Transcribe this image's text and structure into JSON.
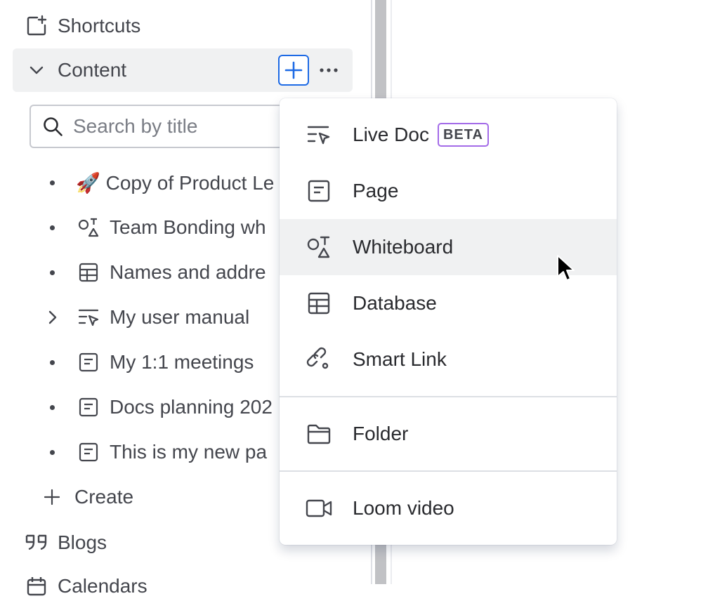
{
  "sidebar": {
    "shortcuts_label": "Shortcuts",
    "content_label": "Content",
    "search_placeholder": "Search by title",
    "tree": [
      {
        "label": "🚀  Copy of Product Le",
        "icon": "emoji-rocket"
      },
      {
        "label": "Team Bonding wh",
        "icon": "whiteboard-icon"
      },
      {
        "label": "Names and addre",
        "icon": "database-icon"
      },
      {
        "label": "My user manual",
        "icon": "live-doc-icon"
      },
      {
        "label": "My 1:1 meetings",
        "icon": "page-icon"
      },
      {
        "label": "Docs planning 202",
        "icon": "page-icon"
      },
      {
        "label": "This is my new pa",
        "icon": "page-icon"
      }
    ],
    "create_label": "Create",
    "blogs_label": "Blogs",
    "calendars_label": "Calendars"
  },
  "menu": {
    "items": [
      {
        "label": "Live Doc",
        "icon": "live-doc-icon",
        "badge": "BETA"
      },
      {
        "label": "Page",
        "icon": "page-icon"
      },
      {
        "label": "Whiteboard",
        "icon": "whiteboard-icon"
      },
      {
        "label": "Database",
        "icon": "database-icon"
      },
      {
        "label": "Smart Link",
        "icon": "smart-link-icon"
      },
      {
        "label": "Folder",
        "icon": "folder-icon"
      },
      {
        "label": "Loom video",
        "icon": "video-icon"
      }
    ]
  },
  "colors": {
    "accent": "#1d6ae5",
    "beta_border": "#a36be8",
    "hover_bg": "#f0f1f2"
  }
}
